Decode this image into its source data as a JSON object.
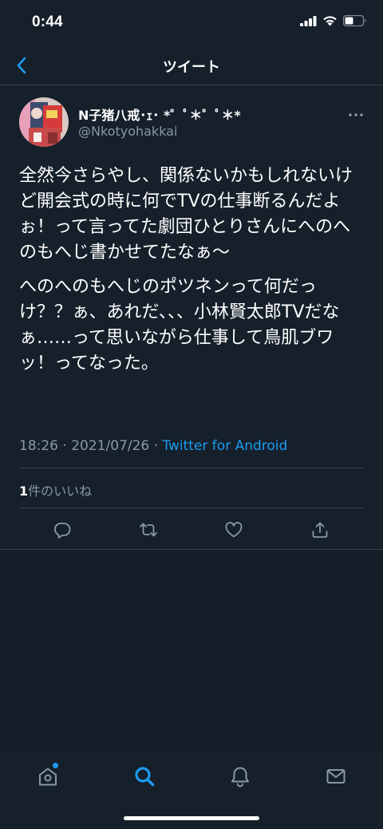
{
  "status_bar": {
    "time": "0:44",
    "icons": [
      "signal-icon",
      "wifi-icon",
      "battery-icon"
    ]
  },
  "header": {
    "title": "ツイート",
    "back_icon": "back-arrow-icon"
  },
  "tweet": {
    "author": {
      "display_name": "N子猪八戒･ｪ･ *゜ﾟ＊゜ﾟ＊*",
      "handle": "@Nkotyohakkai"
    },
    "text_paragraphs": [
      "全然今さらやし、関係ないかもしれないけど開会式の時に何でTVの仕事断るんだよぉ！って言ってた劇団ひとりさんにへのへのもへじ書かせてたなぁ〜",
      "へのへのもへじのポツネンって何だっけ？？ぁ、あれだ、、、小林賢太郎TVだなぁ……って思いながら仕事して鳥肌ブワッ！ってなった。"
    ],
    "time": "18:26",
    "separator": "·",
    "date": "2021/07/26",
    "source": "Twitter for Android",
    "likes_count": "1",
    "likes_label": "件のいいね",
    "actions": [
      "reply-icon",
      "retweet-icon",
      "like-icon",
      "share-icon"
    ]
  },
  "tab_bar": {
    "items": [
      "home-icon",
      "search-icon",
      "notifications-icon",
      "messages-icon"
    ],
    "active": "search-icon"
  },
  "colors": {
    "background": "#15202b",
    "accent": "#1d9bf0",
    "secondary_text": "#8b98a5",
    "divider": "#38444d"
  }
}
